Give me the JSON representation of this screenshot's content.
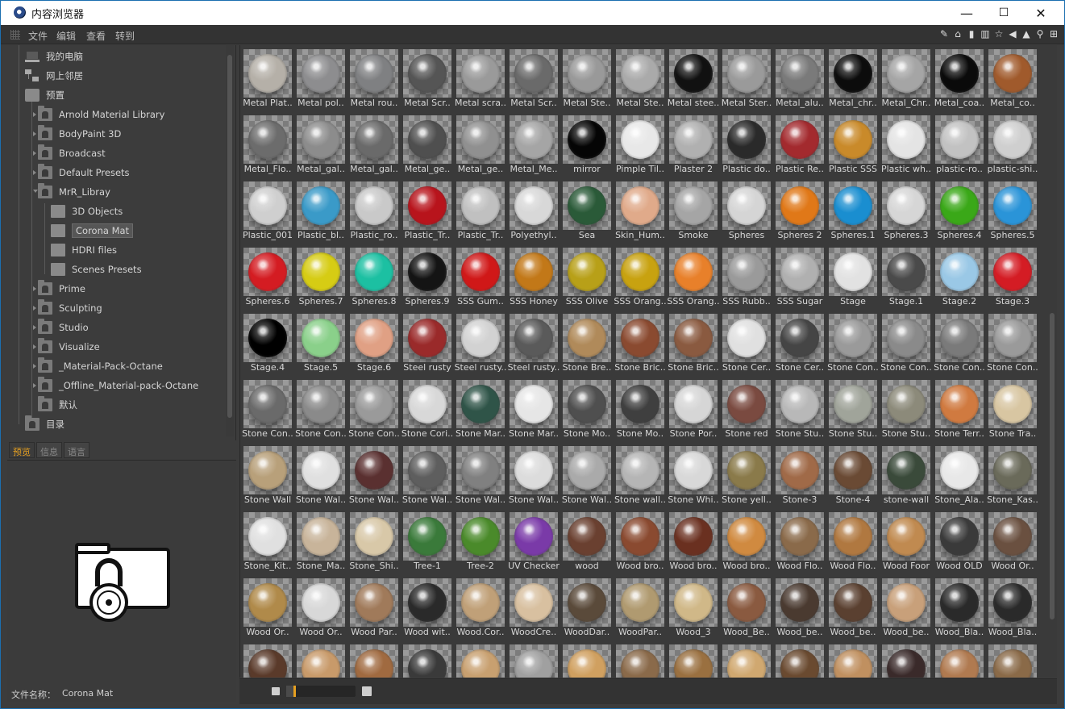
{
  "window": {
    "title": "内容浏览器",
    "minimize": "—",
    "maximize": "☐",
    "close": "✕"
  },
  "menu": [
    "文件",
    "编辑",
    "查看",
    "转到"
  ],
  "toolbar_icons": [
    "edit-icon",
    "home-icon",
    "bin-icon",
    "book-icon",
    "star-icon",
    "back-icon",
    "up-icon",
    "search-icon",
    "add-icon"
  ],
  "tree": [
    {
      "label": "我的电脑",
      "icon": "computer-icon",
      "depth": 0
    },
    {
      "label": "网上邻居",
      "icon": "network-icon",
      "depth": 0
    },
    {
      "label": "预置",
      "icon": "preset-icon",
      "depth": 0
    },
    {
      "label": "Arnold Material Library",
      "icon": "preset-folder-icon",
      "depth": 1
    },
    {
      "label": "BodyPaint 3D",
      "icon": "preset-folder-icon",
      "depth": 1
    },
    {
      "label": "Broadcast",
      "icon": "preset-folder-icon",
      "depth": 1
    },
    {
      "label": "Default Presets",
      "icon": "preset-folder-icon",
      "depth": 1
    },
    {
      "label": "MrR_Libray",
      "icon": "preset-folder-icon",
      "depth": 1
    },
    {
      "label": "3D Objects",
      "icon": "category-icon",
      "depth": 2
    },
    {
      "label": "Corona Mat",
      "icon": "category-icon",
      "depth": 2,
      "selected": true
    },
    {
      "label": "HDRI files",
      "icon": "category-icon",
      "depth": 2
    },
    {
      "label": "Scenes Presets",
      "icon": "category-icon",
      "depth": 2
    },
    {
      "label": "Prime",
      "icon": "preset-folder-icon",
      "depth": 1
    },
    {
      "label": "Sculpting",
      "icon": "preset-folder-icon",
      "depth": 1
    },
    {
      "label": "Studio",
      "icon": "preset-folder-icon",
      "depth": 1
    },
    {
      "label": "Visualize",
      "icon": "preset-folder-icon",
      "depth": 1
    },
    {
      "label": "_Material-Pack-Octane",
      "icon": "preset-folder-icon",
      "depth": 1
    },
    {
      "label": "_Offline_Material-pack-Octane",
      "icon": "preset-folder-icon",
      "depth": 1
    },
    {
      "label": "默认",
      "icon": "folder-icon",
      "depth": 1
    },
    {
      "label": "目录",
      "icon": "catalog-icon",
      "depth": 0
    }
  ],
  "tabs": [
    "预览",
    "信息",
    "语言"
  ],
  "preview": {
    "filename_label": "文件名称：",
    "filename": "Corona Mat"
  },
  "materials": [
    [
      "Metal Plat..",
      "#b5b0a8"
    ],
    [
      "Metal pol..",
      "#8d8d8f"
    ],
    [
      "Metal rou..",
      "#7f8082"
    ],
    [
      "Metal Scr..",
      "#555"
    ],
    [
      "Metal scra..",
      "#9a9a9a"
    ],
    [
      "Metal Scr..",
      "#6a6a6a"
    ],
    [
      "Metal Ste..",
      "#999"
    ],
    [
      "Metal Ste..",
      "#aaa"
    ],
    [
      "Metal stee..",
      "#111"
    ],
    [
      "Metal Ster..",
      "#9a9a9a"
    ],
    [
      "Metal_alu..",
      "#7a7a7a"
    ],
    [
      "Metal_chr..",
      "#0c0c0c"
    ],
    [
      "Metal_Chr..",
      "#a5a5a5"
    ],
    [
      "Metal_coa..",
      "#0a0a0a"
    ],
    [
      "Metal_co..",
      "#a05a2c"
    ],
    [
      "Metal_Flo..",
      "#6c6c6c"
    ],
    [
      "Metal_gal..",
      "#8c8c8c"
    ],
    [
      "Metal_gal..",
      "#6a6a6a"
    ],
    [
      "Metal_ge..",
      "#4f4f4f"
    ],
    [
      "Metal_ge..",
      "#909090"
    ],
    [
      "Metal_Me..",
      "#a5a5a5"
    ],
    [
      "mirror",
      "#050505"
    ],
    [
      "Pimple Til..",
      "#e8e8e8"
    ],
    [
      "Plaster 2",
      "#b0b0b0"
    ],
    [
      "Plastic do..",
      "#2a2a2a"
    ],
    [
      "Plastic Re..",
      "#a32a2e"
    ],
    [
      "Plastic SSS",
      "#c98a2a"
    ],
    [
      "Plastic wh..",
      "#e4e4e4"
    ],
    [
      "plastic-ro..",
      "#c2c2c2"
    ],
    [
      "plastic-shi..",
      "#cfcfcf"
    ],
    [
      "Plastic_001",
      "#cfcfcf"
    ],
    [
      "Plastic_bl..",
      "#3a9ac8"
    ],
    [
      "Plastic_ro..",
      "#c9c9c9"
    ],
    [
      "Plastic_Tr..",
      "#b8141c"
    ],
    [
      "Plastic_Tr..",
      "#c0c0c0"
    ],
    [
      "Polyethyl..",
      "#d8d8d8"
    ],
    [
      "Sea",
      "#2a5a38"
    ],
    [
      "Skin_Hum..",
      "#e0aa8a"
    ],
    [
      "Smoke",
      "#a5a5a5"
    ],
    [
      "Spheres",
      "#d5d5d5"
    ],
    [
      "Spheres 2",
      "#e07818"
    ],
    [
      "Spheres.1",
      "#1a8ed0"
    ],
    [
      "Spheres.3",
      "#d6d6d6"
    ],
    [
      "Spheres.4",
      "#3aa818"
    ],
    [
      "Spheres.5",
      "#2a94d8"
    ],
    [
      "Spheres.6",
      "#d41c22"
    ],
    [
      "Spheres.7",
      "#d6cc14"
    ],
    [
      "Spheres.8",
      "#1cc0a2"
    ],
    [
      "Spheres.9",
      "#141414"
    ],
    [
      "SSS Gum..",
      "#d01818"
    ],
    [
      "SSS Honey",
      "#c27818"
    ],
    [
      "SSS Olive",
      "#b8a018"
    ],
    [
      "SSS Orang..",
      "#c8a210"
    ],
    [
      "SSS Orang..",
      "#e8802a"
    ],
    [
      "SSS Rubb..",
      "#9a9a9a"
    ],
    [
      "SSS Sugar",
      "#b0b0b0"
    ],
    [
      "Stage",
      "#e2e2e2"
    ],
    [
      "Stage.1",
      "#4a4a4a"
    ],
    [
      "Stage.2",
      "#9ac8e6"
    ],
    [
      "Stage.3",
      "#d41c24"
    ],
    [
      "Stage.4",
      "#000"
    ],
    [
      "Stage.5",
      "#8ad08a"
    ],
    [
      "Stage.6",
      "#e0a084"
    ],
    [
      "Steel rusty",
      "#9a2a2a"
    ],
    [
      "Steel rusty..",
      "#d2d2d2"
    ],
    [
      "Steel rusty..",
      "#5a5a5a"
    ],
    [
      "Stone Bre..",
      "#b08a5a"
    ],
    [
      "Stone Bric..",
      "#8a4a30"
    ],
    [
      "Stone Bric..",
      "#8a5a40"
    ],
    [
      "Stone Cer..",
      "#e0e0e0"
    ],
    [
      "Stone Cer..",
      "#454545"
    ],
    [
      "Stone Con..",
      "#9a9a9a"
    ],
    [
      "Stone Con..",
      "#8a8a8a"
    ],
    [
      "Stone Con..",
      "#7a7a7a"
    ],
    [
      "Stone Con..",
      "#9a9a9a"
    ],
    [
      "Stone Con..",
      "#6a6a6a"
    ],
    [
      "Stone Con..",
      "#8a8a8a"
    ],
    [
      "Stone Con..",
      "#9a9a9a"
    ],
    [
      "Stone Cori..",
      "#d8d8d8"
    ],
    [
      "Stone Mar..",
      "#2f5448"
    ],
    [
      "Stone Mar..",
      "#e6e6e6"
    ],
    [
      "Stone Mo..",
      "#4f4f4f"
    ],
    [
      "Stone Mo..",
      "#3f3f3f"
    ],
    [
      "Stone Por..",
      "#d6d6d6"
    ],
    [
      "Stone red",
      "#7a4a40"
    ],
    [
      "Stone Stu..",
      "#b8b8b8"
    ],
    [
      "Stone Stu..",
      "#a0a49a"
    ],
    [
      "Stone Stu..",
      "#8c8a7a"
    ],
    [
      "Stone Terr..",
      "#d07a40"
    ],
    [
      "Stone Tra..",
      "#d8c6a2"
    ],
    [
      "Stone Wall",
      "#b8a07a"
    ],
    [
      "Stone Wal..",
      "#e0e0e0"
    ],
    [
      "Stone Wal..",
      "#5a3030"
    ],
    [
      "Stone Wal..",
      "#5e5e5e"
    ],
    [
      "Stone Wal..",
      "#808080"
    ],
    [
      "Stone Wal..",
      "#dcdcdc"
    ],
    [
      "Stone Wal..",
      "#aaa"
    ],
    [
      "Stone wall..",
      "#b5b5b5"
    ],
    [
      "Stone Whi..",
      "#d8d8d8"
    ],
    [
      "Stone yell..",
      "#8a7a4a"
    ],
    [
      "Stone-3",
      "#a06a48"
    ],
    [
      "Stone-4",
      "#6a4a34"
    ],
    [
      "stone-wall",
      "#3a4a3a"
    ],
    [
      "Stone_Ala..",
      "#e8e8e8"
    ],
    [
      "Stone_Kas..",
      "#6a6a5a"
    ],
    [
      "Stone_Kit..",
      "#e0e0e0"
    ],
    [
      "Stone_Ma..",
      "#c8b49a"
    ],
    [
      "Stone_Shi..",
      "#d8c8a8"
    ],
    [
      "Tree-1",
      "#3a7a3a"
    ],
    [
      "Tree-2",
      "#4a8a2a"
    ],
    [
      "UV Checker",
      "#7a3aa8"
    ],
    [
      "wood",
      "#6a4030"
    ],
    [
      "Wood bro..",
      "#8a4a30"
    ],
    [
      "Wood bro..",
      "#6a3020"
    ],
    [
      "Wood bro..",
      "#d08a40"
    ],
    [
      "Wood Flo..",
      "#8a6a4a"
    ],
    [
      "Wood Flo..",
      "#b07840"
    ],
    [
      "Wood Foor",
      "#c08a50"
    ],
    [
      "Wood OLD",
      "#3a3a3a"
    ],
    [
      "Wood Or..",
      "#6a5040"
    ],
    [
      "Wood Or..",
      "#b08a4a"
    ],
    [
      "Wood Or..",
      "#d8d8d8"
    ],
    [
      "Wood Par..",
      "#a07a5a"
    ],
    [
      "Wood wit..",
      "#2a2a2a"
    ],
    [
      "Wood.Cor..",
      "#c0a078"
    ],
    [
      "WoodCre..",
      "#d8c0a0"
    ],
    [
      "WoodDar..",
      "#5a4a3a"
    ],
    [
      "WoodPar..",
      "#b09a70"
    ],
    [
      "Wood_3",
      "#d0b888"
    ],
    [
      "Wood_Be..",
      "#8a5a40"
    ],
    [
      "Wood_be..",
      "#4a3a30"
    ],
    [
      "Wood_be..",
      "#5a4030"
    ],
    [
      "Wood_be..",
      "#c8a07a"
    ],
    [
      "Wood_Bla..",
      "#2a2a2a"
    ],
    [
      "Wood_Bla..",
      "#2a2a2a"
    ],
    [
      "",
      "#5a3a2a"
    ],
    [
      "",
      "#c89a6a"
    ],
    [
      "",
      "#a06a40"
    ],
    [
      "",
      "#3a3a3a"
    ],
    [
      "",
      "#c8a070"
    ],
    [
      "",
      "#a0a0a0"
    ],
    [
      "",
      "#d0a060"
    ],
    [
      "",
      "#8a6a4a"
    ],
    [
      "",
      "#9a7040"
    ],
    [
      "",
      "#d0a870"
    ],
    [
      "",
      "#6a4a30"
    ],
    [
      "",
      "#c09060"
    ],
    [
      "",
      "#3a2a2a"
    ],
    [
      "",
      "#b07a50"
    ],
    [
      "",
      "#8a6a48"
    ]
  ],
  "bottom_icons": [
    "small-view-icon",
    "large-view-icon"
  ],
  "zoom_level": 0.1
}
